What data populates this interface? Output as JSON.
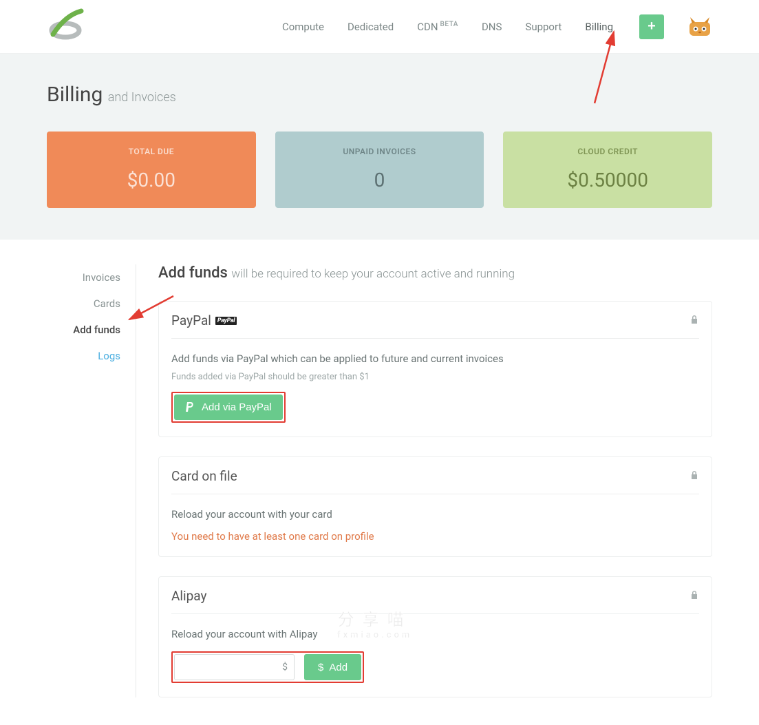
{
  "nav": {
    "items": [
      "Compute",
      "Dedicated",
      "CDN",
      "DNS",
      "Support",
      "Billing"
    ],
    "beta_tag": "BETA"
  },
  "header": {
    "title": "Billing",
    "subtitle": "and Invoices"
  },
  "stats": {
    "total_due": {
      "label": "TOTAL DUE",
      "value": "$0.00"
    },
    "unpaid": {
      "label": "UNPAID INVOICES",
      "value": "0"
    },
    "credit": {
      "label": "CLOUD CREDIT",
      "value": "$0.50000"
    }
  },
  "sidebar": {
    "items": [
      "Invoices",
      "Cards",
      "Add funds",
      "Logs"
    ]
  },
  "content": {
    "title": "Add funds",
    "subtitle": "will be required to keep your account active and running"
  },
  "paypal": {
    "title": "PayPal",
    "logo_text": "PayPal",
    "desc": "Add funds via PayPal which can be applied to future and current invoices",
    "note": "Funds added via PayPal should be greater than $1",
    "button": "Add via PayPal"
  },
  "card_on_file": {
    "title": "Card on file",
    "desc": "Reload your account with your card",
    "warn": "You need to have at least one card on profile"
  },
  "alipay": {
    "title": "Alipay",
    "desc": "Reload your account with Alipay",
    "currency": "$",
    "input_value": "",
    "button": "Add"
  },
  "watermark": {
    "line1": "分享喵",
    "line2": "fxmiao.com"
  }
}
